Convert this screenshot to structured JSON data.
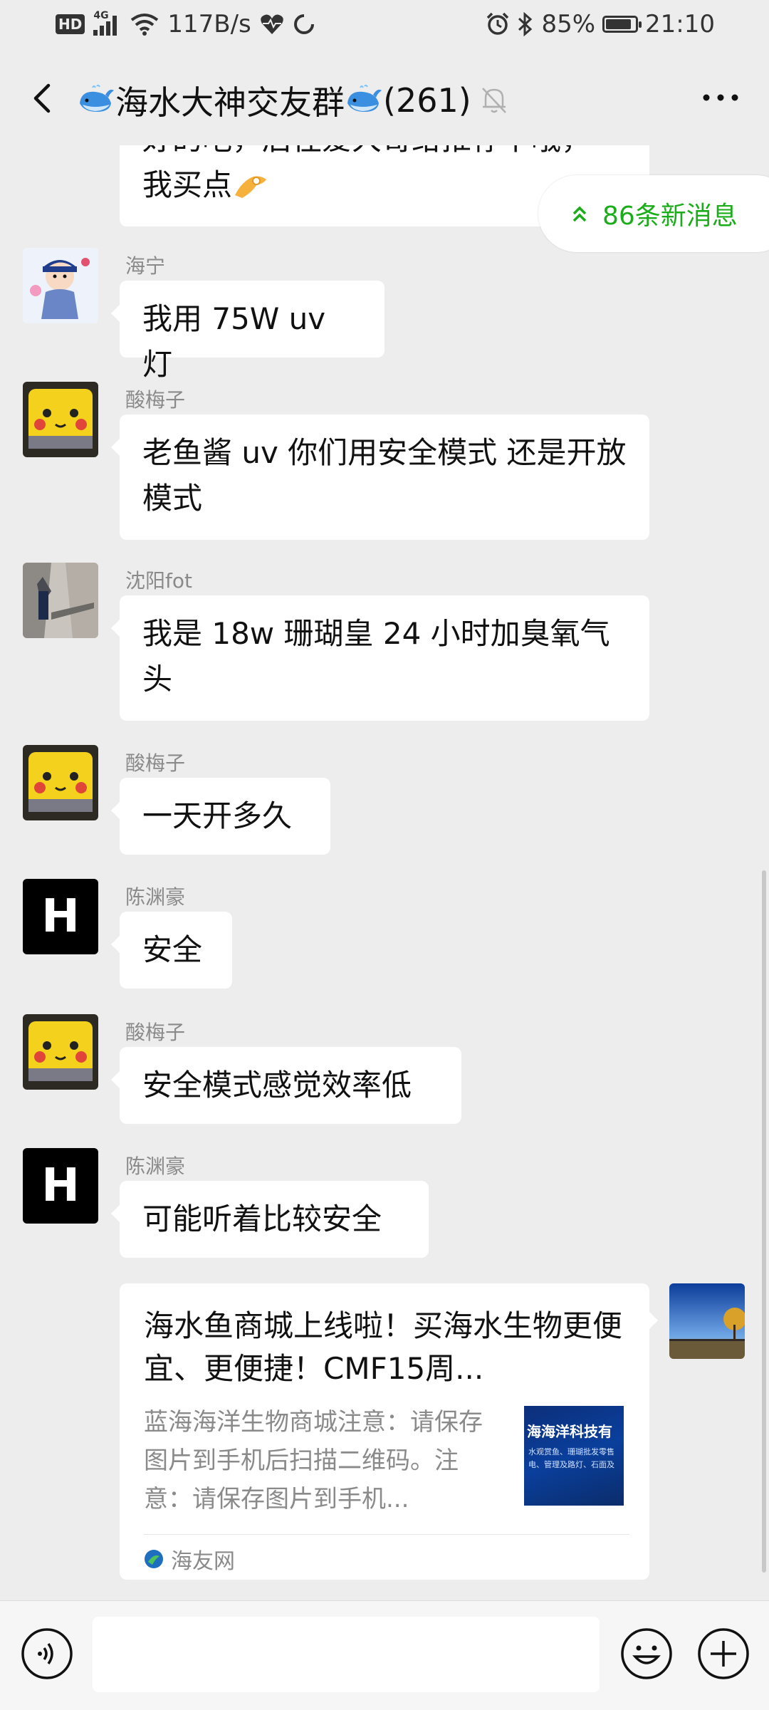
{
  "status_bar": {
    "hd": "HD",
    "network_gen": "4G",
    "speed": "117B/s",
    "battery": "85%",
    "time": "21:10"
  },
  "nav": {
    "title": "海水大神交友群",
    "count": "(261)"
  },
  "new_messages": "86条新消息",
  "top_partial_message": {
    "line1": "好的吧，后径爱大哥给推荐下哦，",
    "line2": "我买点"
  },
  "messages": [
    {
      "sender": "海宁",
      "text": "我用 75W uv 灯"
    },
    {
      "sender": "酸梅子",
      "text": "老鱼酱 uv 你们用安全模式 还是开放模式"
    },
    {
      "sender": "沈阳fot",
      "text": "我是 18w 珊瑚皇 24 小时加臭氧气头"
    },
    {
      "sender": "酸梅子",
      "text": "一天开多久"
    },
    {
      "sender": "陈渊豪",
      "text": "安全"
    },
    {
      "sender": "酸梅子",
      "text": "安全模式感觉效率低"
    },
    {
      "sender": "陈渊豪",
      "text": "可能听着比较安全"
    }
  ],
  "avatar_letter": "H",
  "link_card": {
    "title": "海水鱼商城上线啦！买海水生物更便宜、更便捷！CMF15周...",
    "description": "蓝海海洋生物商城注意：请保存图片到手机后扫描二维码。注意：请保存图片到手机...",
    "thumb_text": "海海洋科技有",
    "thumb_line1": "水观赏鱼、珊瑚批发零售",
    "thumb_line2": "电、管理及路灯、石面及",
    "source": "海友网"
  },
  "colors": {
    "background": "#ededed",
    "bubble": "#ffffff",
    "accent_green": "#1aad19",
    "sender_gray": "#8a8a8a"
  },
  "icons": [
    "back-arrow-icon",
    "whale-emoji-icon",
    "mute-bell-icon",
    "more-icon",
    "double-chevron-up-icon",
    "voice-icon",
    "emoji-icon",
    "plus-icon"
  ]
}
